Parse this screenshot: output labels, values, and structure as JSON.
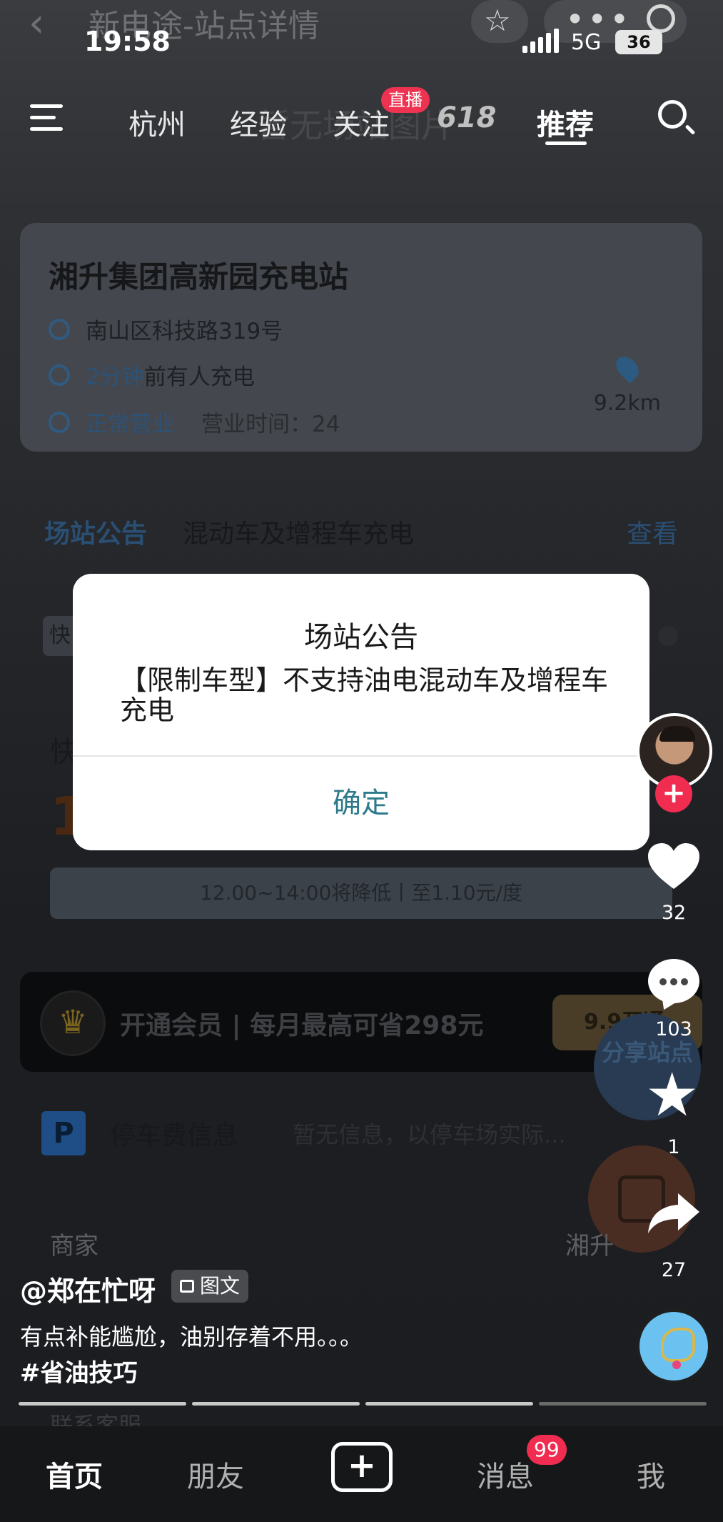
{
  "status_bar": {
    "app_title": "新电途-站点详情",
    "time": "19:58",
    "network": "5G",
    "battery": "36"
  },
  "tabs": {
    "items": [
      "杭州",
      "经验",
      "关注",
      "618",
      "推荐"
    ],
    "live_badge": "直播",
    "active": "推荐"
  },
  "background": {
    "watermark": "暂无场站图片",
    "station_name": "湘升集团高新园充电站",
    "address": "南山区科技路319号",
    "recent_charge_highlight": "2分钟",
    "recent_charge_rest": "前有人充电",
    "status": "正常营业",
    "hours": "营业时间：24",
    "distance": "9.2km",
    "notice_tag": "场站公告",
    "notice_text": "混动车及增程车充电",
    "notice_more": "查看",
    "fast_tag": "快",
    "fast_label": "快",
    "price_big": "1",
    "price_bar": "12.00~14:00将降低丨至1.10元/度",
    "vip_text": "开通会员 | 每月最高可省298元",
    "vip_button": "9.9开通",
    "share_fab": "分享站点",
    "parking_icon": "P",
    "parking_label": "停车费信息",
    "parking_info": "暂无信息，以停车场实际...",
    "merchant": "商家",
    "merchant_right": "湘升",
    "contact": "联系客服"
  },
  "dialog": {
    "title": "场站公告",
    "body": "【限制车型】不支持油电混动车及增程车充电",
    "confirm": "确定"
  },
  "rail": {
    "likes": "32",
    "comments": "103",
    "favorites": "1",
    "shares": "27",
    "follow_plus": "+"
  },
  "post": {
    "author": "@郑在忙呀",
    "type_badge": "图文",
    "caption": "有点补能尴尬，油别存着不用。。。",
    "hashtag": "#省油技巧"
  },
  "progress": {
    "segments": 4,
    "active": 3
  },
  "bottom_nav": {
    "home": "首页",
    "friends": "朋友",
    "plus": "+",
    "messages": "消息",
    "messages_badge": "99",
    "me": "我"
  },
  "colors": {
    "accent_red": "#f02d50",
    "dialog_button": "#2c7a8a",
    "live_badge": "#ee3352"
  }
}
